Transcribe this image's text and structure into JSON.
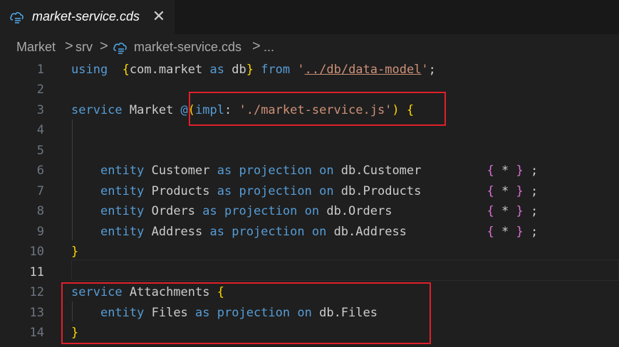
{
  "tab": {
    "icon": "cds-file-icon",
    "title": "market-service.cds",
    "close_glyph": "✕"
  },
  "breadcrumb": {
    "items": [
      "Market",
      "srv",
      "market-service.cds",
      "..."
    ],
    "separator": ">"
  },
  "editor": {
    "active_line": "11",
    "lines": [
      {
        "n": "1",
        "tokens": [
          [
            "kw",
            "using"
          ],
          [
            "",
            "  "
          ],
          [
            "br1",
            "{"
          ],
          [
            "",
            "com.market "
          ],
          [
            "kw",
            "as"
          ],
          [
            "",
            " db"
          ],
          [
            "br1",
            "}"
          ],
          [
            "",
            ""
          ],
          [
            "kw",
            " from"
          ],
          [
            "",
            " "
          ],
          [
            "str",
            "'"
          ],
          [
            "strl",
            "../db/data-model"
          ],
          [
            "str",
            "'"
          ],
          [
            "",
            ";"
          ]
        ]
      },
      {
        "n": "2",
        "tokens": []
      },
      {
        "n": "3",
        "tokens": [
          [
            "kw",
            "service"
          ],
          [
            "",
            " Market "
          ],
          [
            "kw",
            "@"
          ],
          [
            "br1",
            "("
          ],
          [
            "kw",
            "impl"
          ],
          [
            "",
            ": "
          ],
          [
            "str",
            "'./market-service.js'"
          ],
          [
            "br1",
            ")"
          ],
          [
            "",
            " "
          ],
          [
            "br1",
            "{"
          ]
        ]
      },
      {
        "n": "4",
        "tokens": []
      },
      {
        "n": "5",
        "tokens": []
      },
      {
        "n": "6",
        "tokens": [
          [
            "",
            "    "
          ],
          [
            "kw",
            "entity"
          ],
          [
            "",
            " Customer "
          ],
          [
            "kw",
            "as"
          ],
          [
            "",
            " "
          ],
          [
            "kw",
            "projection"
          ],
          [
            "",
            " "
          ],
          [
            "kw",
            "on"
          ],
          [
            "",
            " db.Customer         "
          ],
          [
            "br2",
            "{"
          ],
          [
            "",
            " * "
          ],
          [
            "br2",
            "}"
          ],
          [
            "",
            " ;"
          ]
        ]
      },
      {
        "n": "7",
        "tokens": [
          [
            "",
            "    "
          ],
          [
            "kw",
            "entity"
          ],
          [
            "",
            " Products "
          ],
          [
            "kw",
            "as"
          ],
          [
            "",
            " "
          ],
          [
            "kw",
            "projection"
          ],
          [
            "",
            " "
          ],
          [
            "kw",
            "on"
          ],
          [
            "",
            " db.Products         "
          ],
          [
            "br2",
            "{"
          ],
          [
            "",
            " * "
          ],
          [
            "br2",
            "}"
          ],
          [
            "",
            " ;"
          ]
        ]
      },
      {
        "n": "8",
        "tokens": [
          [
            "",
            "    "
          ],
          [
            "kw",
            "entity"
          ],
          [
            "",
            " Orders "
          ],
          [
            "kw",
            "as"
          ],
          [
            "",
            " "
          ],
          [
            "kw",
            "projection"
          ],
          [
            "",
            " "
          ],
          [
            "kw",
            "on"
          ],
          [
            "",
            " db.Orders             "
          ],
          [
            "br2",
            "{"
          ],
          [
            "",
            " * "
          ],
          [
            "br2",
            "}"
          ],
          [
            "",
            " ;"
          ]
        ]
      },
      {
        "n": "9",
        "tokens": [
          [
            "",
            "    "
          ],
          [
            "kw",
            "entity"
          ],
          [
            "",
            " Address "
          ],
          [
            "kw",
            "as"
          ],
          [
            "",
            " "
          ],
          [
            "kw",
            "projection"
          ],
          [
            "",
            " "
          ],
          [
            "kw",
            "on"
          ],
          [
            "",
            " db.Address           "
          ],
          [
            "br2",
            "{"
          ],
          [
            "",
            " * "
          ],
          [
            "br2",
            "}"
          ],
          [
            "",
            " ;"
          ]
        ]
      },
      {
        "n": "10",
        "tokens": [
          [
            "br1",
            "}"
          ]
        ]
      },
      {
        "n": "11",
        "tokens": []
      },
      {
        "n": "12",
        "tokens": [
          [
            "kw",
            "service"
          ],
          [
            "",
            " Attachments "
          ],
          [
            "br1",
            "{"
          ]
        ]
      },
      {
        "n": "13",
        "tokens": [
          [
            "",
            "    "
          ],
          [
            "kw",
            "entity"
          ],
          [
            "",
            " Files "
          ],
          [
            "kw",
            "as"
          ],
          [
            "",
            " "
          ],
          [
            "kw",
            "projection"
          ],
          [
            "",
            " "
          ],
          [
            "kw",
            "on"
          ],
          [
            "",
            " db.Files"
          ]
        ]
      },
      {
        "n": "14",
        "tokens": [
          [
            "br1",
            "}"
          ]
        ]
      }
    ]
  },
  "colors": {
    "background": "#1f1f1f",
    "keyword": "#569cd6",
    "string": "#ce9178",
    "bracket_gold": "#ffd700",
    "bracket_magenta": "#da70d6",
    "highlight_box": "#e0202a"
  }
}
